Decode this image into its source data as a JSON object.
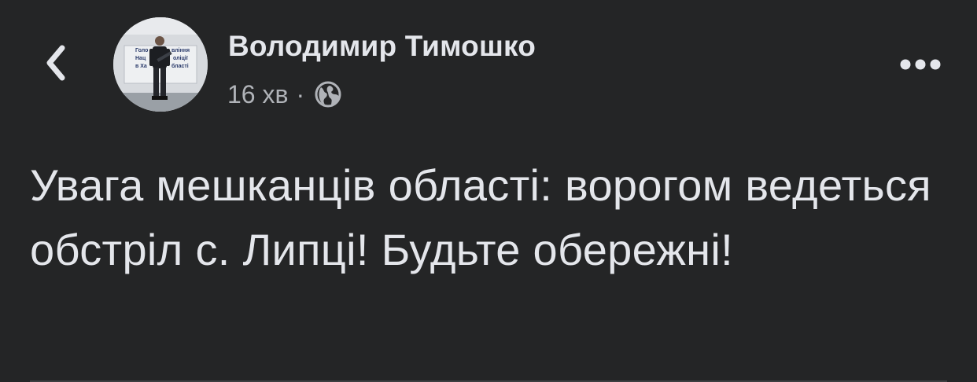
{
  "post": {
    "author_name": "Володимир Тимошко",
    "time": "16 хв",
    "separator": "·",
    "privacy_icon": "globe-icon",
    "text": "Увага мешканців області: ворогом ведеться обстріл с. Липці! Будьте обережні!",
    "avatar_backdrop_text": [
      "Голо",
      "вління",
      "Нац",
      "оліції",
      "в Ха",
      "бласті"
    ]
  },
  "icons": {
    "back": "chevron-left-icon",
    "more": "more-horizontal-icon"
  },
  "colors": {
    "background": "#242526",
    "primary_text": "#e4e6eb",
    "secondary_text": "#b0b3b8"
  }
}
